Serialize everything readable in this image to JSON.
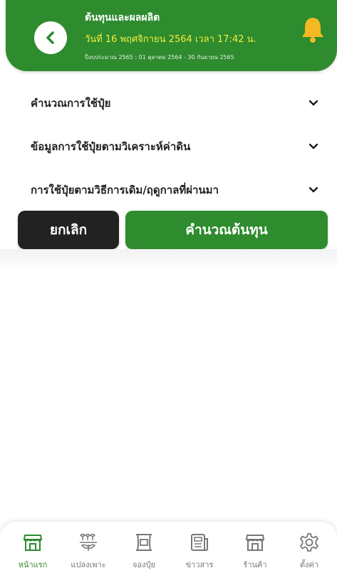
{
  "header": {
    "title": "ต้นทุนและผลผลิต",
    "date": "วันที่ 16 พฤศจิกายน 2564 เวลา 17:42 น.",
    "budget_year": "ปีงบประมาณ 2565 : 01 ตุลาคม 2564 - 30 กันยายน 2565"
  },
  "accordions": [
    {
      "label": "คำนวณการใช้ปุ๋ย"
    },
    {
      "label": "ข้อมูลการใช้ปุ๋ยตามวิเคราะห์ค่าดิน"
    },
    {
      "label": "การใช้ปุ๋ยตามวิธีการเดิม/ฤดูกาลที่ผ่านมา"
    }
  ],
  "buttons": {
    "cancel": "ยกเลิก",
    "calculate": "คำนวณต้นทุน"
  },
  "nav": [
    {
      "label": "หน้าแรก",
      "icon": "store-icon"
    },
    {
      "label": "แปลงเพาะ",
      "icon": "sprout-icon"
    },
    {
      "label": "จองปุ๋ย",
      "icon": "fertilizer-sack-icon"
    },
    {
      "label": "ข่าวสาร",
      "icon": "newspaper-icon"
    },
    {
      "label": "ร้านค้า",
      "icon": "shop-icon"
    },
    {
      "label": "ตั้งค่า",
      "icon": "gear-icon"
    }
  ],
  "colors": {
    "primary": "#2e8b2e",
    "date_text": "#f4ee3a",
    "cancel": "#222222",
    "bell": "#f5b921"
  }
}
